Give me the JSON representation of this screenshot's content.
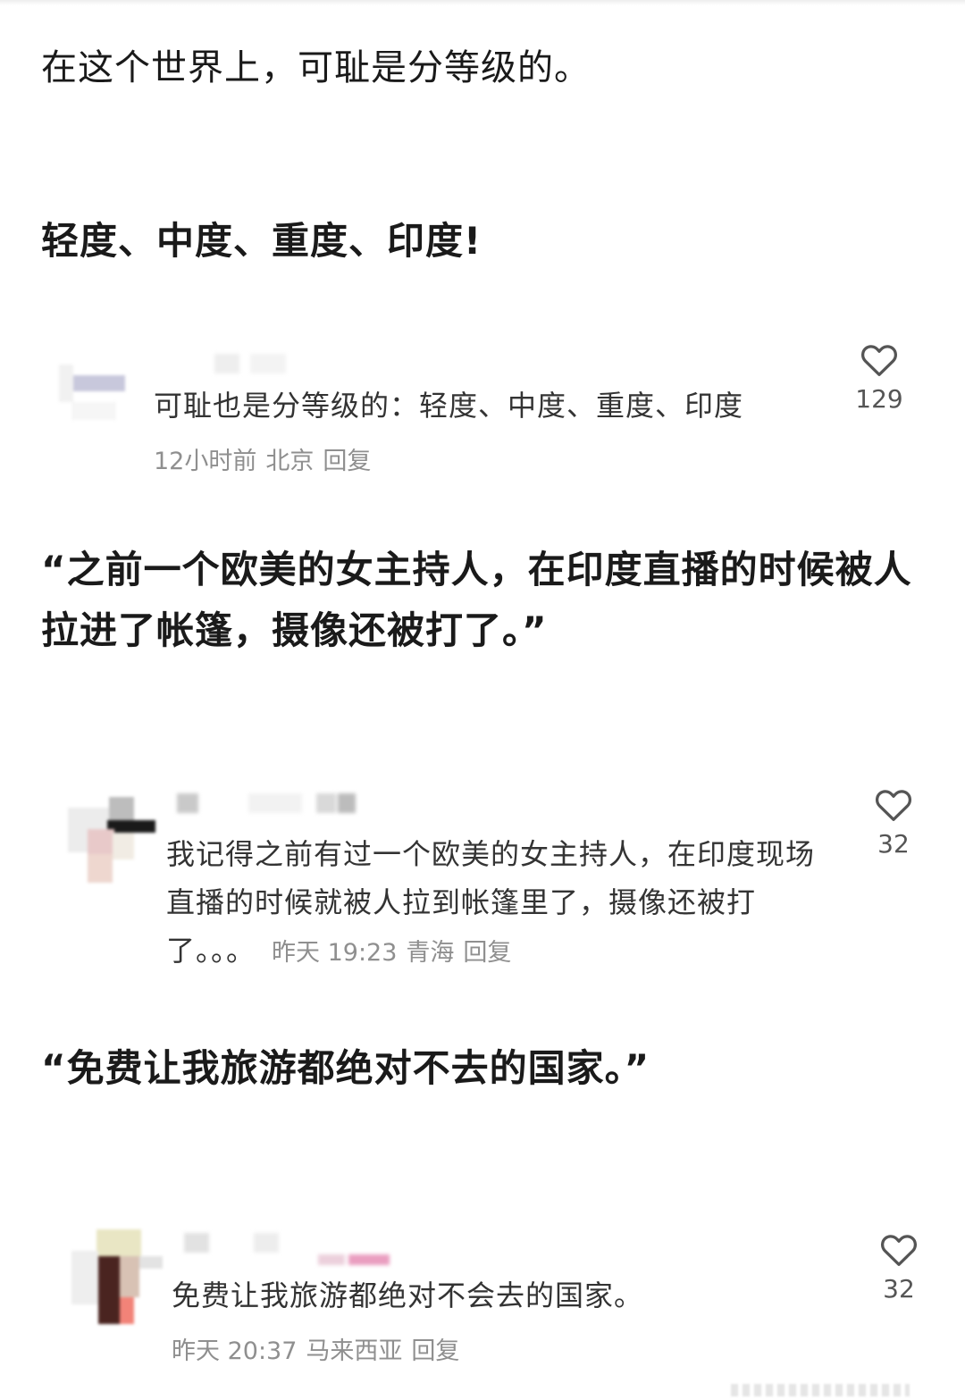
{
  "post": {
    "line1": "在这个世界上，可耻是分等级的。",
    "line2": "轻度、中度、重度、印度!",
    "quote1": "“之前一个欧美的女主持人，在印度直播的时候被人拉进了帐篷，摄像还被打了。”",
    "quote2": "“免费让我旅游都绝对不去的国家。”"
  },
  "comments": [
    {
      "text": "可耻也是分等级的：轻度、中度、重度、印度",
      "time": "12小时前",
      "location": "北京",
      "reply_label": "回复",
      "likes": "129",
      "like_icon": "heart-outline-icon"
    },
    {
      "text": "我记得之前有过一个欧美的女主持人，在印度现场直播的时候就被人拉到帐篷里了，摄像还被打了。。。",
      "time": "昨天 19:23",
      "location": "青海",
      "reply_label": "回复",
      "likes": "32",
      "like_icon": "heart-outline-icon"
    },
    {
      "text": "免费让我旅游都绝对不会去的国家。",
      "time": "昨天 20:37",
      "location": "马来西亚",
      "reply_label": "回复",
      "likes": "32",
      "like_icon": "heart-outline-icon"
    }
  ],
  "colors": {
    "text_primary": "#1a1a1a",
    "text_comment": "#333333",
    "text_meta": "#8f8f8f",
    "heart_stroke": "#555555"
  }
}
